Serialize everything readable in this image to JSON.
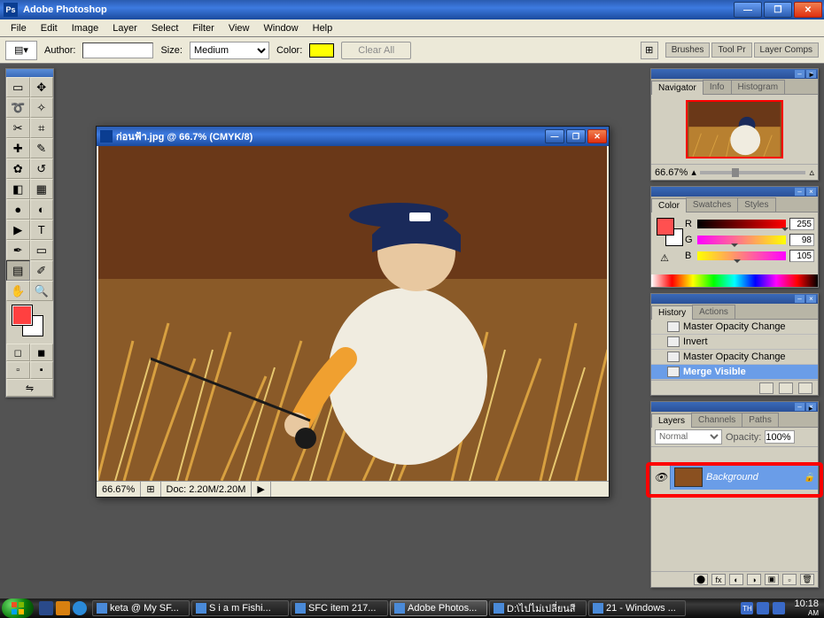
{
  "app": {
    "title": "Adobe Photoshop"
  },
  "menu": [
    "File",
    "Edit",
    "Image",
    "Layer",
    "Select",
    "Filter",
    "View",
    "Window",
    "Help"
  ],
  "options": {
    "author_label": "Author:",
    "author_value": "",
    "size_label": "Size:",
    "size_value": "Medium",
    "color_label": "Color:",
    "color_swatch": "#ffff00",
    "clear_label": "Clear All",
    "palette_tabs": [
      "Brushes",
      "Tool Pr",
      "Layer Comps"
    ]
  },
  "toolbox": {
    "tools": [
      {
        "name": "marquee",
        "glyph": "▭"
      },
      {
        "name": "move",
        "glyph": "✥"
      },
      {
        "name": "lasso",
        "glyph": "➰"
      },
      {
        "name": "magic-wand",
        "glyph": "✧"
      },
      {
        "name": "crop",
        "glyph": "✂"
      },
      {
        "name": "slice",
        "glyph": "⌗"
      },
      {
        "name": "healing",
        "glyph": "✚"
      },
      {
        "name": "brush",
        "glyph": "✎"
      },
      {
        "name": "clone",
        "glyph": "✿"
      },
      {
        "name": "history-brush",
        "glyph": "↺"
      },
      {
        "name": "eraser",
        "glyph": "◧"
      },
      {
        "name": "gradient",
        "glyph": "▦"
      },
      {
        "name": "blur",
        "glyph": "●"
      },
      {
        "name": "dodge",
        "glyph": "◐"
      },
      {
        "name": "path-select",
        "glyph": "▶"
      },
      {
        "name": "type",
        "glyph": "T"
      },
      {
        "name": "pen",
        "glyph": "✒"
      },
      {
        "name": "shape",
        "glyph": "▭"
      },
      {
        "name": "notes",
        "glyph": "▤",
        "active": true
      },
      {
        "name": "eyedropper",
        "glyph": "✐"
      },
      {
        "name": "hand",
        "glyph": "✋"
      },
      {
        "name": "zoom",
        "glyph": "🔍"
      }
    ],
    "fg_color": "#ff4040",
    "bg_color": "#ffffff"
  },
  "document": {
    "title": "ก่อนฟ้า.jpg @ 66.7% (CMYK/8)",
    "zoom": "66.67%",
    "doc_size": "Doc: 2.20M/2.20M"
  },
  "panels": {
    "navigator": {
      "tabs": [
        "Navigator",
        "Info",
        "Histogram"
      ],
      "zoom": "66.67%"
    },
    "color": {
      "tabs": [
        "Color",
        "Swatches",
        "Styles"
      ],
      "channels": [
        {
          "label": "R",
          "value": "255"
        },
        {
          "label": "G",
          "value": "98"
        },
        {
          "label": "B",
          "value": "105"
        }
      ],
      "warn": "⚠"
    },
    "history": {
      "tabs": [
        "History",
        "Actions"
      ],
      "items": [
        {
          "label": "Master Opacity Change",
          "active": false
        },
        {
          "label": "Invert",
          "active": false
        },
        {
          "label": "Master Opacity Change",
          "active": false
        },
        {
          "label": "Merge Visible",
          "active": true
        }
      ]
    },
    "layers": {
      "tabs": [
        "Layers",
        "Channels",
        "Paths"
      ],
      "blend_mode": "Normal",
      "opacity_label": "Opacity:",
      "opacity_value": "100%",
      "layer": {
        "name": "Background"
      }
    }
  },
  "taskbar": {
    "items": [
      {
        "label": "keta @ My SF...",
        "active": false
      },
      {
        "label": "S i a m Fishi...",
        "active": false
      },
      {
        "label": "SFC item 217...",
        "active": false
      },
      {
        "label": "Adobe Photos...",
        "active": true
      },
      {
        "label": "D:\\ไปไม่เปลี่ยนสี",
        "active": false
      },
      {
        "label": "21 - Windows ...",
        "active": false
      }
    ],
    "lang": "TH",
    "time": "10:18",
    "period": "AM"
  }
}
